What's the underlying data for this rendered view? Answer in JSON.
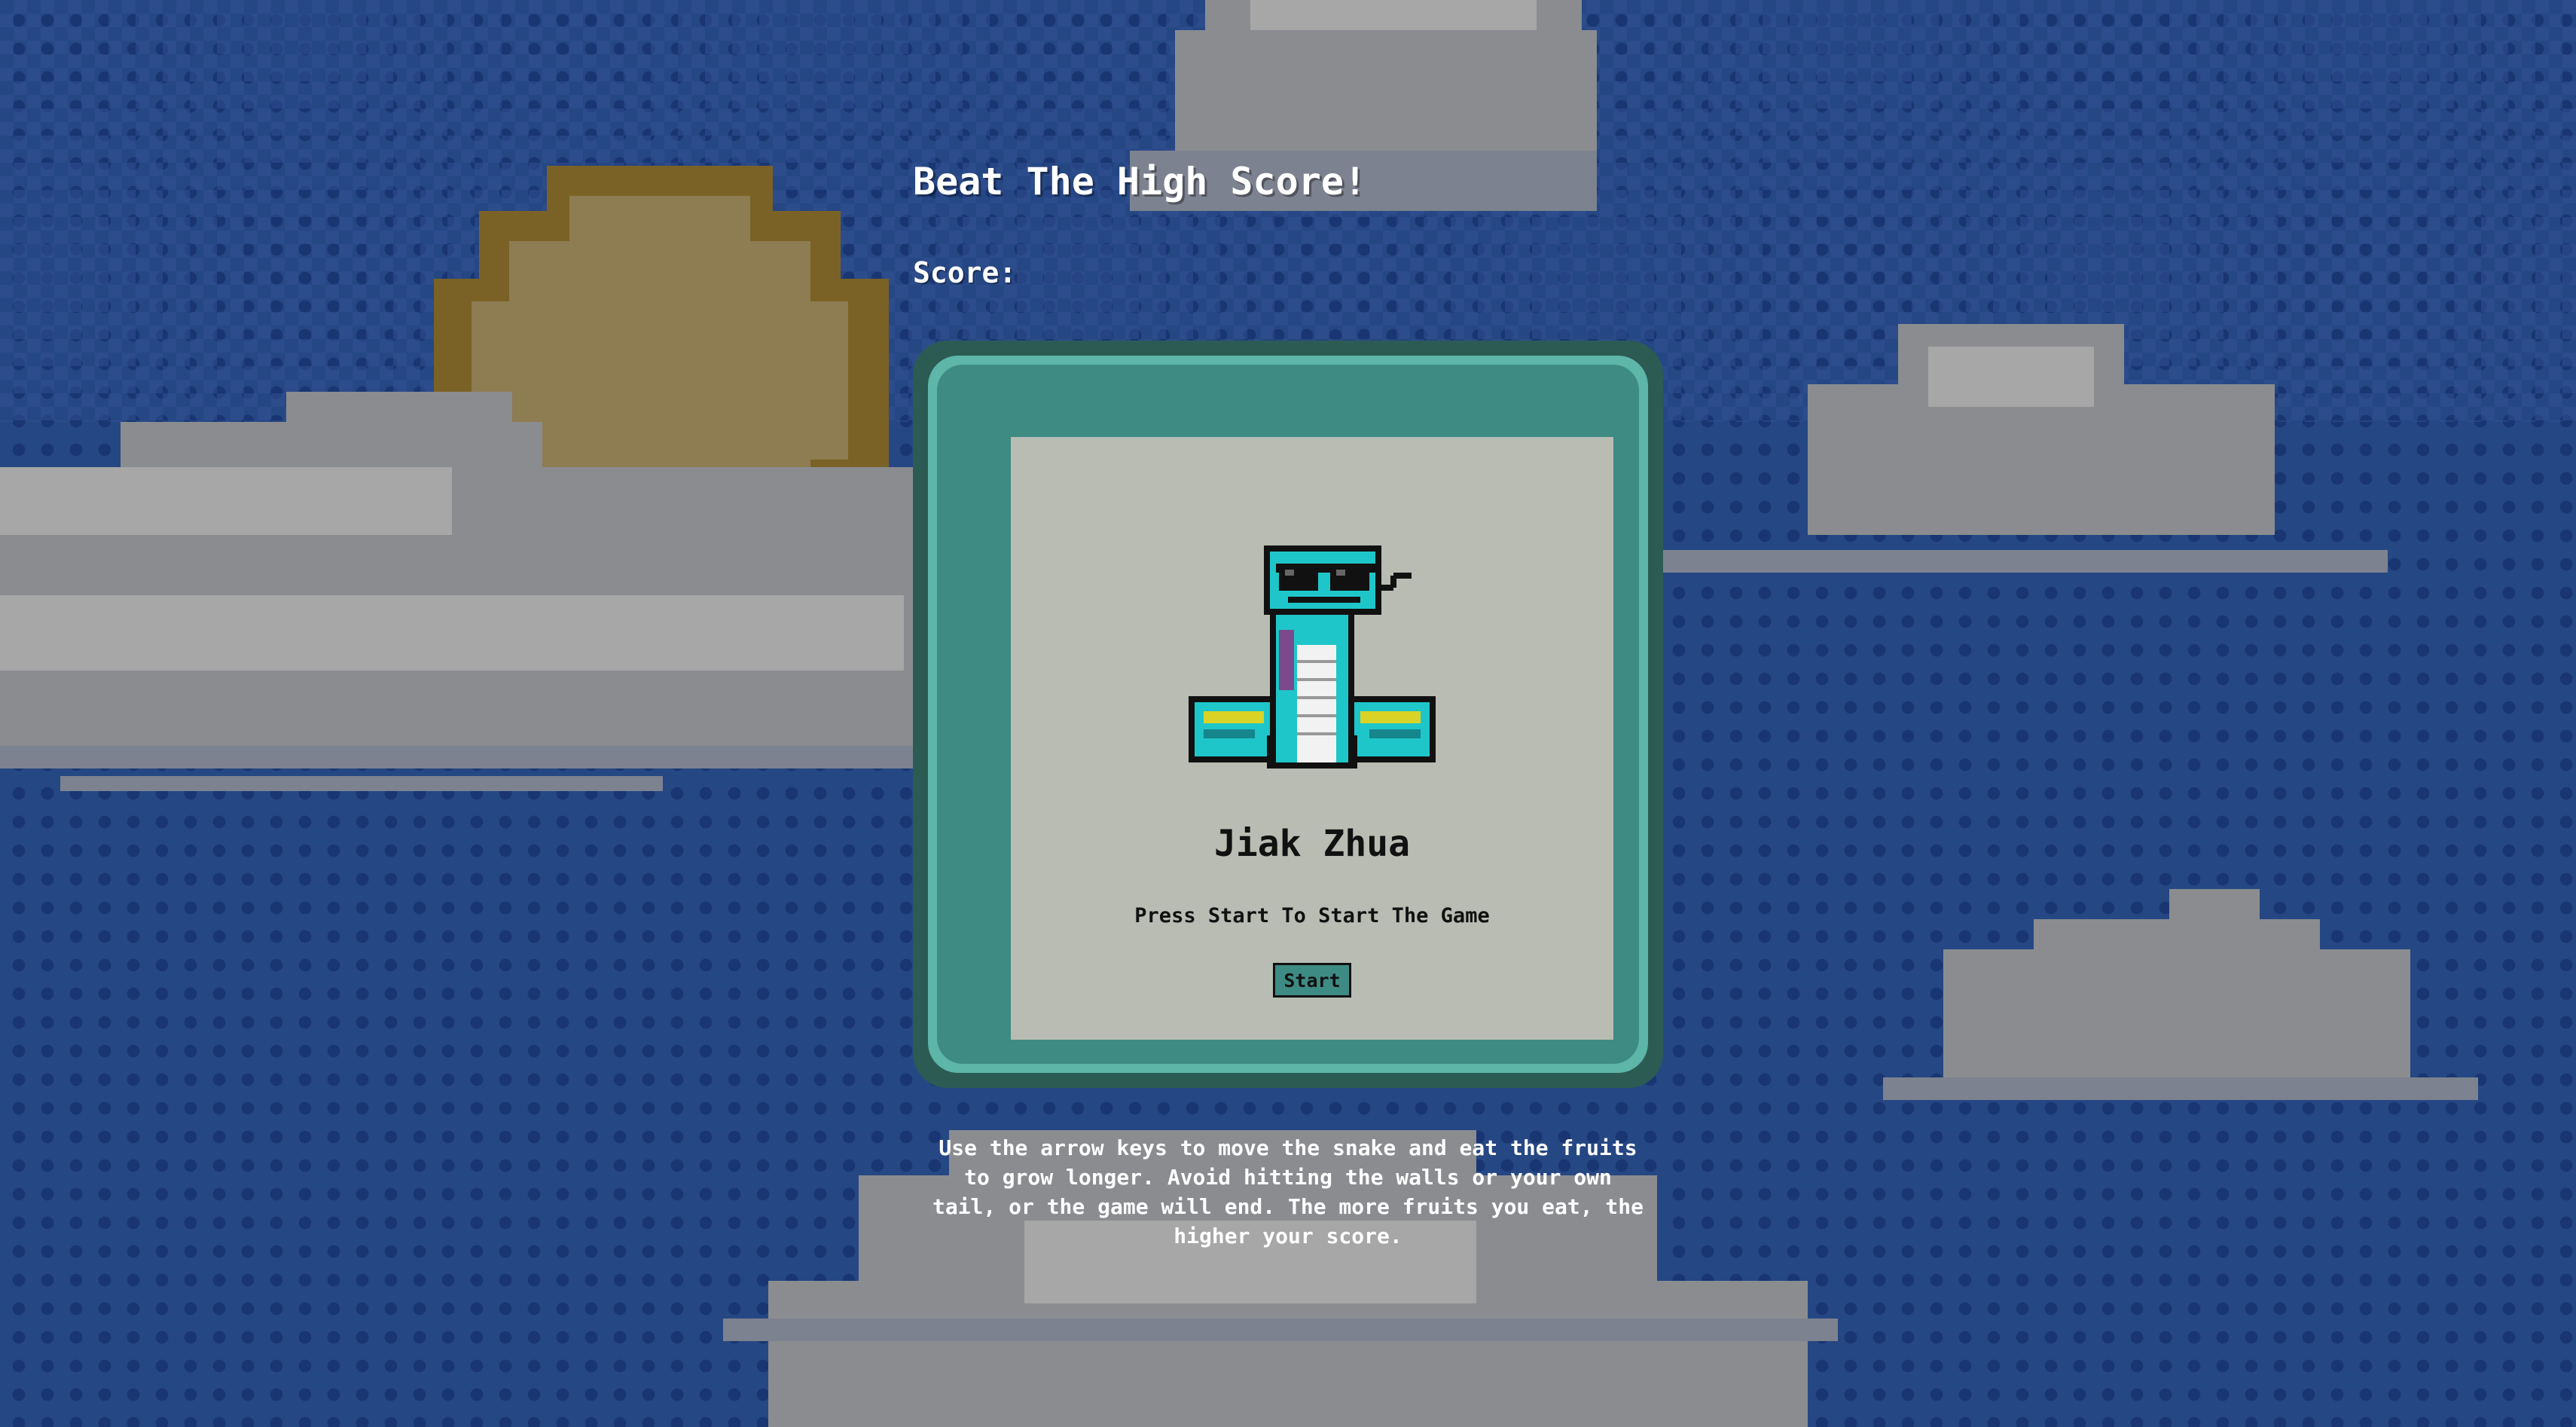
{
  "page": {
    "title": "Beat The High Score!",
    "score_label": "Score:",
    "score_value": ""
  },
  "game": {
    "name": "Jiak Zhua",
    "prompt": "Press Start To Start The Game",
    "start_label": "Start"
  },
  "instructions": "Use the arrow keys to move the snake and eat the fruits to grow longer. Avoid hitting the walls or your own tail, or the game will end. The more fruits you eat, the higher your score.",
  "icons": {
    "mascot": "snake-with-sunglasses-icon",
    "background": [
      "pixel-sun",
      "pixel-cloud"
    ]
  },
  "colors": {
    "sky": "#254783",
    "console_frame": "#2c5b54",
    "console_rim": "#5db6a8",
    "console_body": "#3e8b84",
    "screen": "#b8bcb2",
    "snake": "#1fc6c9",
    "text_light": "#ffffff",
    "text_dark": "#111111"
  }
}
